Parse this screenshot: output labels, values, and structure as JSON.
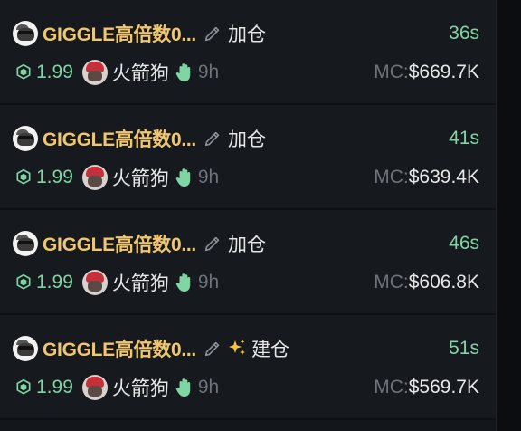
{
  "items": [
    {
      "token": "GIGGLE高倍数0...",
      "action": "加仓",
      "sparkle": false,
      "time": "36s",
      "amount": "1.99",
      "user": "火箭狗",
      "age": "9h",
      "mc_label": "MC:",
      "mc_value": "$669.7K"
    },
    {
      "token": "GIGGLE高倍数0...",
      "action": "加仓",
      "sparkle": false,
      "time": "41s",
      "amount": "1.99",
      "user": "火箭狗",
      "age": "9h",
      "mc_label": "MC:",
      "mc_value": "$639.4K"
    },
    {
      "token": "GIGGLE高倍数0...",
      "action": "加仓",
      "sparkle": false,
      "time": "46s",
      "amount": "1.99",
      "user": "火箭狗",
      "age": "9h",
      "mc_label": "MC:",
      "mc_value": "$606.8K"
    },
    {
      "token": "GIGGLE高倍数0...",
      "action": "建仓",
      "sparkle": true,
      "time": "51s",
      "amount": "1.99",
      "user": "火箭狗",
      "age": "9h",
      "mc_label": "MC:",
      "mc_value": "$569.7K"
    }
  ],
  "colors": {
    "token": "#f0c66e",
    "green": "#7fd6a3",
    "muted": "#6d737b",
    "text": "#e8e8e8",
    "background": "#16191e"
  },
  "icons": {
    "token_avatar": "dog-avatar-icon",
    "edit": "pencil-icon",
    "new_position": "sparkle-icon",
    "chain": "bnb-cube-icon",
    "user_avatar": "rocket-dog-avatar-icon",
    "hand": "waving-hand-icon"
  }
}
